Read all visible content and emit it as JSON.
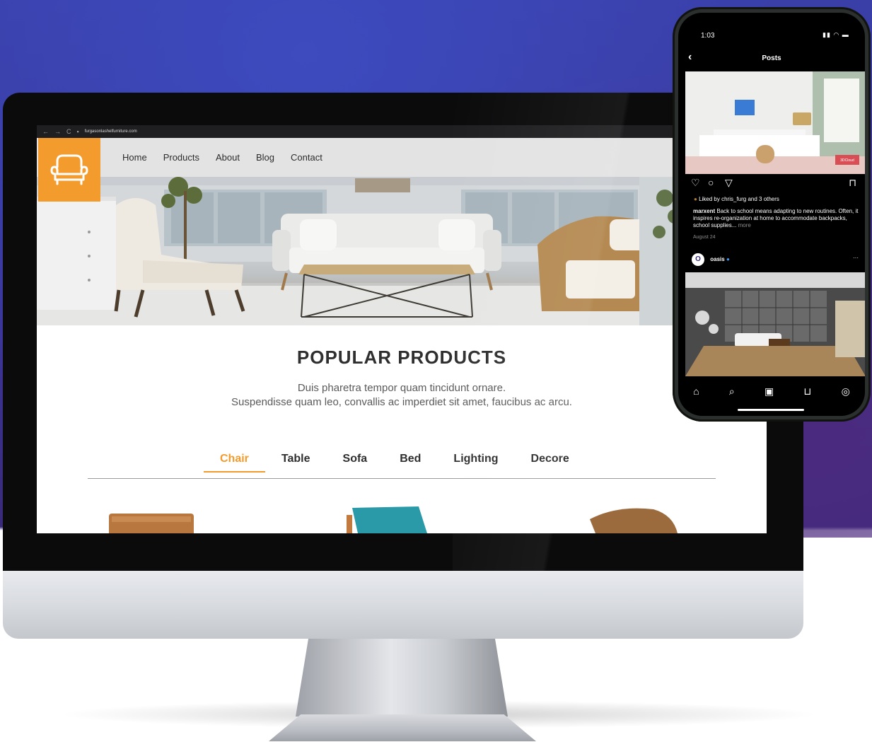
{
  "browser": {
    "url": "furgasonlashelfurniture.com",
    "back_icon": "arrow-left-icon",
    "forward_icon": "arrow-right-icon",
    "reload_icon": "reload-icon"
  },
  "site": {
    "logo_icon": "armchair-icon",
    "nav": [
      "Home",
      "Products",
      "About",
      "Blog",
      "Contact"
    ],
    "heading": "POPULAR PRODUCTS",
    "subtext_line1": "Duis pharetra tempor quam tincidunt ornare.",
    "subtext_line2": "Suspendisse quam leo, convallis ac imperdiet sit amet, faucibus ac arcu.",
    "tabs": [
      "Chair",
      "Table",
      "Sofa",
      "Bed",
      "Lighting",
      "Decore"
    ],
    "active_tab": "Chair",
    "accent_color": "#f39c2d"
  },
  "phone": {
    "time": "1:03",
    "title": "Posts",
    "liked_text": "Liked by chris_furg and 3 others",
    "caption_user": "marxent",
    "caption_text": "Back to school means adapting to new routines. Often, it inspires re-organization at home to accommodate backpacks, school supplies...",
    "caption_more": "more",
    "date": "August 24",
    "post_badge": "3DCloud",
    "next_user": "oasis",
    "next_user_avatar_letter": "O",
    "more_icon": "ellipsis-icon",
    "bottom_nav": [
      "home-icon",
      "search-icon",
      "reels-icon",
      "shop-icon",
      "profile-icon"
    ]
  }
}
